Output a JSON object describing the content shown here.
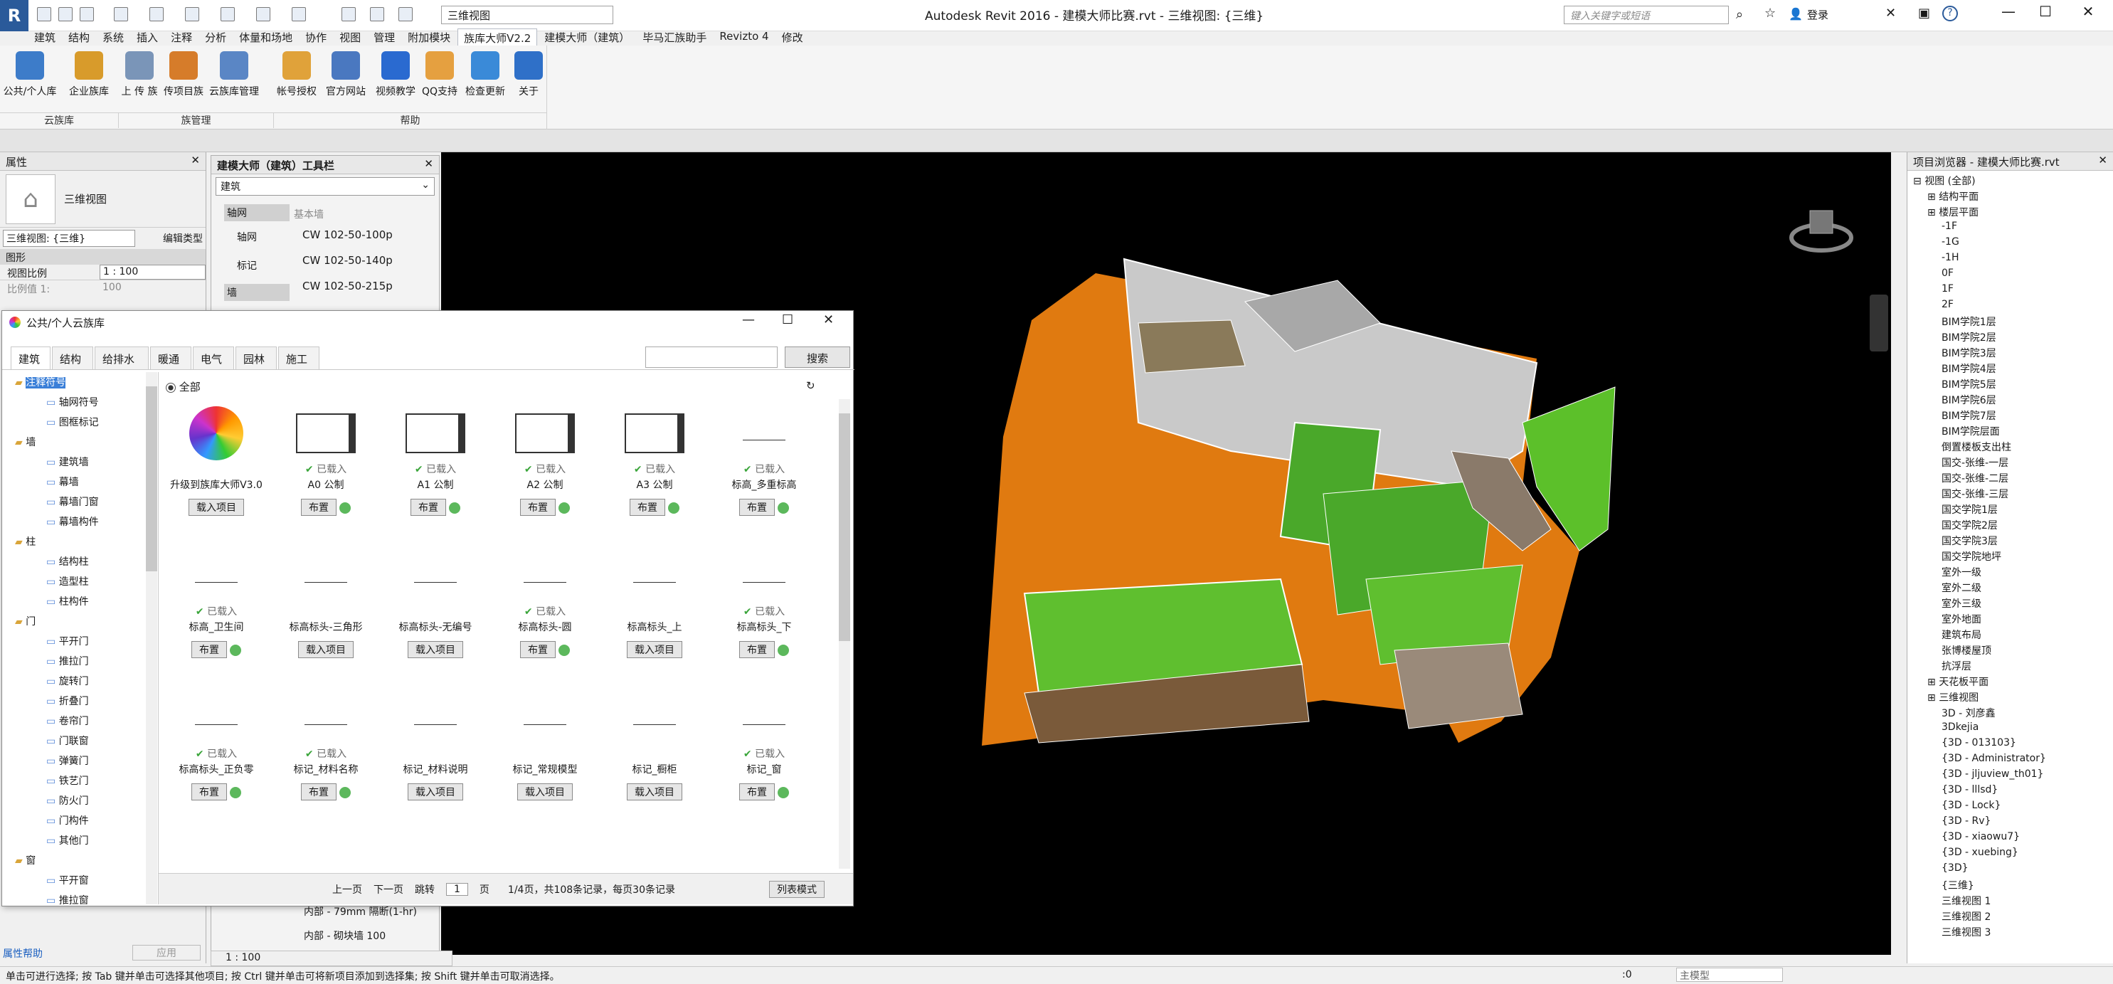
{
  "app": {
    "title": "Autodesk Revit 2016 -    建模大师比赛.rvt - 三维视图: {三维}",
    "logo_letter": "R"
  },
  "quick_access": {
    "view_select": "三维视图"
  },
  "search": {
    "placeholder": "键入关键字或短语"
  },
  "account": {
    "login": "登录"
  },
  "ribbon": {
    "tabs": [
      "建筑",
      "结构",
      "系统",
      "插入",
      "注释",
      "分析",
      "体量和场地",
      "协作",
      "视图",
      "管理",
      "附加模块",
      "族库大师V2.2",
      "建模大师（建筑）",
      "毕马汇族助手",
      "Revizto 4",
      "修改"
    ],
    "active_tab_index": 11,
    "buttons": [
      {
        "label": "公共/个人库",
        "color": "#3d7cc9"
      },
      {
        "label": "企业族库",
        "color": "#d89b2b"
      },
      {
        "label": "上 传 族",
        "color": "#7a95b8"
      },
      {
        "label": "传项目族",
        "color": "#d67c2a"
      },
      {
        "label": "云族库管理",
        "color": "#5a86c5"
      },
      {
        "label": "帐号授权",
        "color": "#e0a23a"
      },
      {
        "label": "官方网站",
        "color": "#4a78c0"
      },
      {
        "label": "视频教学",
        "color": "#2a6ad0"
      },
      {
        "label": "QQ支持",
        "color": "#e5a040"
      },
      {
        "label": "检查更新",
        "color": "#3a8ad8"
      },
      {
        "label": "关于",
        "color": "#2f70c8"
      }
    ],
    "groups": [
      "云族库",
      "族管理",
      "帮助"
    ]
  },
  "properties": {
    "header": "属性",
    "type_name": "三维视图",
    "selector": "三维视图: {三维}",
    "edit_type": "编辑类型",
    "section": "图形",
    "rows": [
      {
        "label": "视图比例",
        "value": "1 : 100"
      },
      {
        "label": "比例值 1:",
        "value": "100"
      }
    ],
    "help_link": "属性帮助",
    "apply": "应用"
  },
  "toolbar_panel": {
    "header": "建模大师（建筑）工具栏",
    "dropdown": "建筑",
    "side_items": [
      "轴网",
      "轴网",
      "标记",
      "墙",
      "基本墙"
    ],
    "list_header": "基本墙",
    "list_items": [
      "CW 102-50-100p",
      "CW 102-50-140p",
      "CW 102-50-215p"
    ],
    "bottom_items": [
      "内部 - 79mm 隔断(1-hr)",
      "内部 - 砌块墙 100"
    ]
  },
  "dialog": {
    "title": "公共/个人云族库",
    "tabs": [
      "建筑",
      "结构",
      "给排水",
      "暖通",
      "电气",
      "园林",
      "施工"
    ],
    "search_button": "搜索",
    "all_label": "全部",
    "tree": [
      {
        "label": "注释符号",
        "level": 0
      },
      {
        "label": "轴网符号",
        "level": 1
      },
      {
        "label": "图框标记",
        "level": 1
      },
      {
        "label": "墙",
        "level": 0
      },
      {
        "label": "建筑墙",
        "level": 1
      },
      {
        "label": "幕墙",
        "level": 1
      },
      {
        "label": "幕墙门窗",
        "level": 1
      },
      {
        "label": "幕墙构件",
        "level": 1
      },
      {
        "label": "柱",
        "level": 0
      },
      {
        "label": "结构柱",
        "level": 1
      },
      {
        "label": "造型柱",
        "level": 1
      },
      {
        "label": "柱构件",
        "level": 1
      },
      {
        "label": "门",
        "level": 0
      },
      {
        "label": "平开门",
        "level": 1
      },
      {
        "label": "推拉门",
        "level": 1
      },
      {
        "label": "旋转门",
        "level": 1
      },
      {
        "label": "折叠门",
        "level": 1
      },
      {
        "label": "卷帘门",
        "level": 1
      },
      {
        "label": "门联窗",
        "level": 1
      },
      {
        "label": "弹簧门",
        "level": 1
      },
      {
        "label": "铁艺门",
        "level": 1
      },
      {
        "label": "防火门",
        "level": 1
      },
      {
        "label": "门构件",
        "level": 1
      },
      {
        "label": "其他门",
        "level": 1
      },
      {
        "label": "窗",
        "level": 0
      },
      {
        "label": "平开窗",
        "level": 1
      },
      {
        "label": "推拉窗",
        "level": 1
      }
    ],
    "items": [
      {
        "name": "升级到族库大师V3.0",
        "loaded": "",
        "button": "载入项目",
        "plus": false
      },
      {
        "name": "A0 公制",
        "loaded": "已载入",
        "button": "布置",
        "plus": true
      },
      {
        "name": "A1 公制",
        "loaded": "已载入",
        "button": "布置",
        "plus": true
      },
      {
        "name": "A2 公制",
        "loaded": "已载入",
        "button": "布置",
        "plus": true
      },
      {
        "name": "A3 公制",
        "loaded": "已载入",
        "button": "布置",
        "plus": true
      },
      {
        "name": "标高_多重标高",
        "loaded": "已载入",
        "button": "布置",
        "plus": true
      },
      {
        "name": "标高_卫生间",
        "loaded": "已载入",
        "button": "布置",
        "plus": true
      },
      {
        "name": "标高标头-三角形",
        "loaded": "",
        "button": "载入项目",
        "plus": false
      },
      {
        "name": "标高标头-无编号",
        "loaded": "",
        "button": "载入项目",
        "plus": false
      },
      {
        "name": "标高标头-圆",
        "loaded": "已载入",
        "button": "布置",
        "plus": true
      },
      {
        "name": "标高标头_上",
        "loaded": "",
        "button": "载入项目",
        "plus": false
      },
      {
        "name": "标高标头_下",
        "loaded": "已载入",
        "button": "布置",
        "plus": true
      },
      {
        "name": "标高标头_正负零",
        "loaded": "已载入",
        "button": "布置",
        "plus": true
      },
      {
        "name": "标记_材料名称",
        "loaded": "已载入",
        "button": "布置",
        "plus": true
      },
      {
        "name": "标记_材料说明",
        "loaded": "",
        "button": "载入项目",
        "plus": false
      },
      {
        "name": "标记_常规模型",
        "loaded": "",
        "button": "载入项目",
        "plus": false
      },
      {
        "name": "标记_橱柜",
        "loaded": "",
        "button": "载入项目",
        "plus": false
      },
      {
        "name": "标记_窗",
        "loaded": "已载入",
        "button": "布置",
        "plus": true
      }
    ],
    "pager": {
      "prev": "上一页",
      "next": "下一页",
      "jump": "跳转",
      "page": "1",
      "page_unit": "页",
      "summary": "1/4页，共108条记录，每页30条记录",
      "list_mode": "列表模式"
    }
  },
  "project_browser": {
    "header": "项目浏览器 - 建模大师比赛.rvt",
    "rows": [
      {
        "label": "视图 (全部)",
        "level": 0
      },
      {
        "label": "结构平面",
        "level": 1
      },
      {
        "label": "楼层平面",
        "level": 1
      },
      {
        "label": "-1F",
        "level": 2
      },
      {
        "label": "-1G",
        "level": 2
      },
      {
        "label": "-1H",
        "level": 2
      },
      {
        "label": "0F",
        "level": 2
      },
      {
        "label": "1F",
        "level": 2
      },
      {
        "label": "2F",
        "level": 2
      },
      {
        "label": "BIM学院1层",
        "level": 2
      },
      {
        "label": "BIM学院2层",
        "level": 2
      },
      {
        "label": "BIM学院3层",
        "level": 2
      },
      {
        "label": "BIM学院4层",
        "level": 2
      },
      {
        "label": "BIM学院5层",
        "level": 2
      },
      {
        "label": "BIM学院6层",
        "level": 2
      },
      {
        "label": "BIM学院7层",
        "level": 2
      },
      {
        "label": "BIM学院层面",
        "level": 2
      },
      {
        "label": "倒置楼板支出柱",
        "level": 2
      },
      {
        "label": "国交-张维-一层",
        "level": 2
      },
      {
        "label": "国交-张维-二层",
        "level": 2
      },
      {
        "label": "国交-张维-三层",
        "level": 2
      },
      {
        "label": "国交学院1层",
        "level": 2
      },
      {
        "label": "国交学院2层",
        "level": 2
      },
      {
        "label": "国交学院3层",
        "level": 2
      },
      {
        "label": "国交学院地坪",
        "level": 2
      },
      {
        "label": "室外一级",
        "level": 2
      },
      {
        "label": "室外二级",
        "level": 2
      },
      {
        "label": "室外三级",
        "level": 2
      },
      {
        "label": "室外地面",
        "level": 2
      },
      {
        "label": "建筑布局",
        "level": 2
      },
      {
        "label": "张博楼屋顶",
        "level": 2
      },
      {
        "label": "抗浮层",
        "level": 2
      },
      {
        "label": "天花板平面",
        "level": 1
      },
      {
        "label": "三维视图",
        "level": 1
      },
      {
        "label": "3D - 刘彦鑫",
        "level": 2
      },
      {
        "label": "3Dkejia",
        "level": 2
      },
      {
        "label": "{3D - 013103}",
        "level": 2
      },
      {
        "label": "{3D - Administrator}",
        "level": 2
      },
      {
        "label": "{3D - jljuview_th01}",
        "level": 2
      },
      {
        "label": "{3D - lllsd}",
        "level": 2
      },
      {
        "label": "{3D - Lock}",
        "level": 2
      },
      {
        "label": "{3D - Rv}",
        "level": 2
      },
      {
        "label": "{3D - xiaowu7}",
        "level": 2
      },
      {
        "label": "{3D - xuebing}",
        "level": 2
      },
      {
        "label": "{3D}",
        "level": 2
      },
      {
        "label": "{三维}",
        "level": 2
      },
      {
        "label": "三维视图 1",
        "level": 2
      },
      {
        "label": "三维视图 2",
        "level": 2
      },
      {
        "label": "三维视图 3",
        "level": 2
      }
    ]
  },
  "view_control": {
    "scale": "1 : 100"
  },
  "status": {
    "text": "单击可进行选择; 按 Tab 键并单击可选择其他项目; 按 Ctrl 键并单击可将新项目添加到选择集; 按 Shift 键并单击可取消选择。",
    "count": ":0",
    "model": "主模型"
  }
}
